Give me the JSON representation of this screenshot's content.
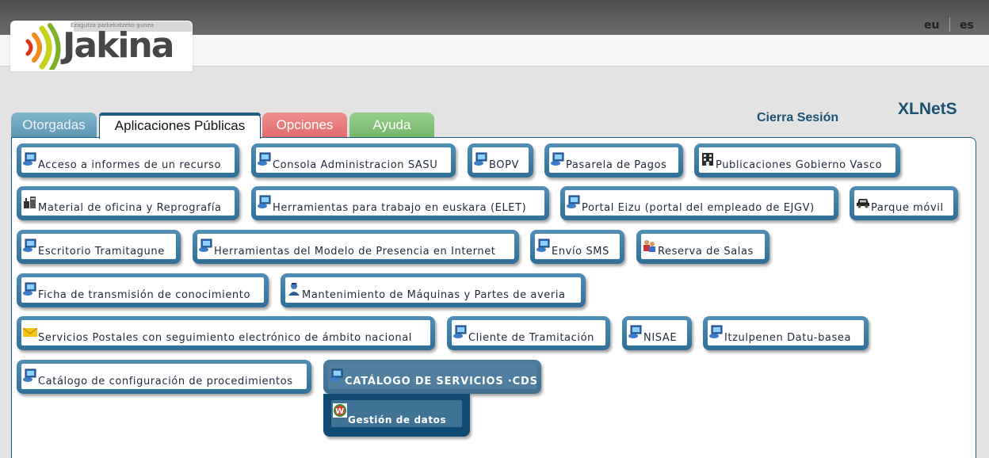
{
  "header": {
    "tagline": "Ezagutza parkekatzeko gunea",
    "logo_text": "Jakina",
    "languages": [
      "eu",
      "es"
    ]
  },
  "tabs": [
    "Otorgadas",
    "Aplicaciones Públicas",
    "Opciones",
    "Ayuda"
  ],
  "active_tab": "Aplicaciones Públicas",
  "session": {
    "logout_label": "Cierra Sesión",
    "brand": "XLNetS"
  },
  "apps": [
    {
      "label": "Acceso a informes de un recurso",
      "icon": "computer-icon"
    },
    {
      "label": "Consola Administracion SASU",
      "icon": "computer-icon"
    },
    {
      "label": "BOPV",
      "icon": "computer-icon"
    },
    {
      "label": "Pasarela de Pagos",
      "icon": "computer-icon"
    },
    {
      "label": "Publicaciones Gobierno Vasco",
      "icon": "building-icon"
    },
    {
      "label": "Material de oficina y Reprografía",
      "icon": "office-supplies-icon"
    },
    {
      "label": "Herramientas para trabajo en euskara (ELET)",
      "icon": "computer-icon"
    },
    {
      "label": "Portal Eizu (portal del empleado de EJGV)",
      "icon": "computer-icon"
    },
    {
      "label": "Parque móvil",
      "icon": "car-icon"
    },
    {
      "label": "Escritorio Tramitagune",
      "icon": "computer-icon"
    },
    {
      "label": "Herramientas del Modelo de Presencia en Internet",
      "icon": "computer-icon"
    },
    {
      "label": "Envío SMS",
      "icon": "computer-icon"
    },
    {
      "label": "Reserva de Salas",
      "icon": "people-icon"
    },
    {
      "label": "Ficha de transmisión de conocimiento",
      "icon": "computer-icon"
    },
    {
      "label": "Mantenimiento de Máquinas y Partes de averia",
      "icon": "technician-icon"
    },
    {
      "label": "Servicios Postales con seguimiento electrónico de ámbito nacional",
      "icon": "envelope-icon"
    },
    {
      "label": "Cliente de Tramitación",
      "icon": "computer-icon"
    },
    {
      "label": "NISAE",
      "icon": "computer-icon"
    },
    {
      "label": "Itzulpenen Datu-basea",
      "icon": "computer-icon"
    },
    {
      "label": "Catálogo de configuración de procedimientos",
      "icon": "computer-icon"
    },
    {
      "label": "CATÁLOGO DE SERVICIOS ·CDS",
      "icon": "computer-icon"
    },
    {
      "label": "Gestión de datos",
      "icon": "w-logo-icon"
    }
  ],
  "colors": {
    "accent": "#1d5d86",
    "tab_otorgadas": "#6fa6c2",
    "tab_opciones": "#e57a7a",
    "tab_ayuda": "#84c379"
  }
}
